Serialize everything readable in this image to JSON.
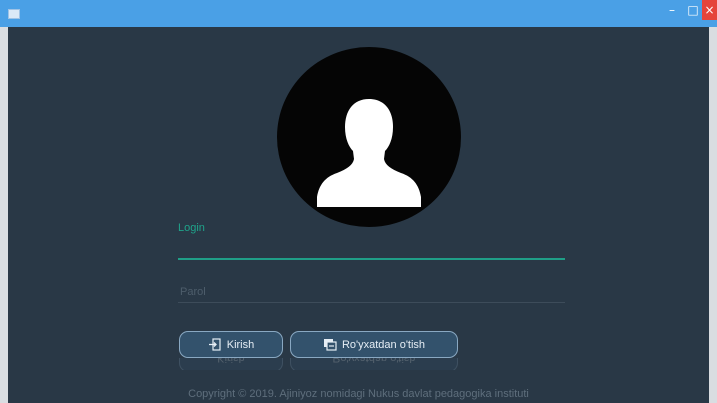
{
  "window": {
    "controls": {
      "minimize": "–",
      "maximize": "□",
      "close": "×"
    }
  },
  "form": {
    "login_label": "Login",
    "login_value": "",
    "parol_placeholder": "Parol",
    "parol_value": ""
  },
  "buttons": {
    "kirish_label": "Kirish",
    "kirish_icon": "enter-icon",
    "register_label": "Ro'yxatdan o'tish",
    "register_icon": "register-icon"
  },
  "footer": {
    "copyright": "Copyright © 2019. Ajiniyoz nomidagi Nukus davlat pedagogika instituti"
  },
  "colors": {
    "title_bar": "#4aa0e6",
    "background": "#293846",
    "accent": "#1f9e87",
    "close_button": "#e5443a"
  }
}
